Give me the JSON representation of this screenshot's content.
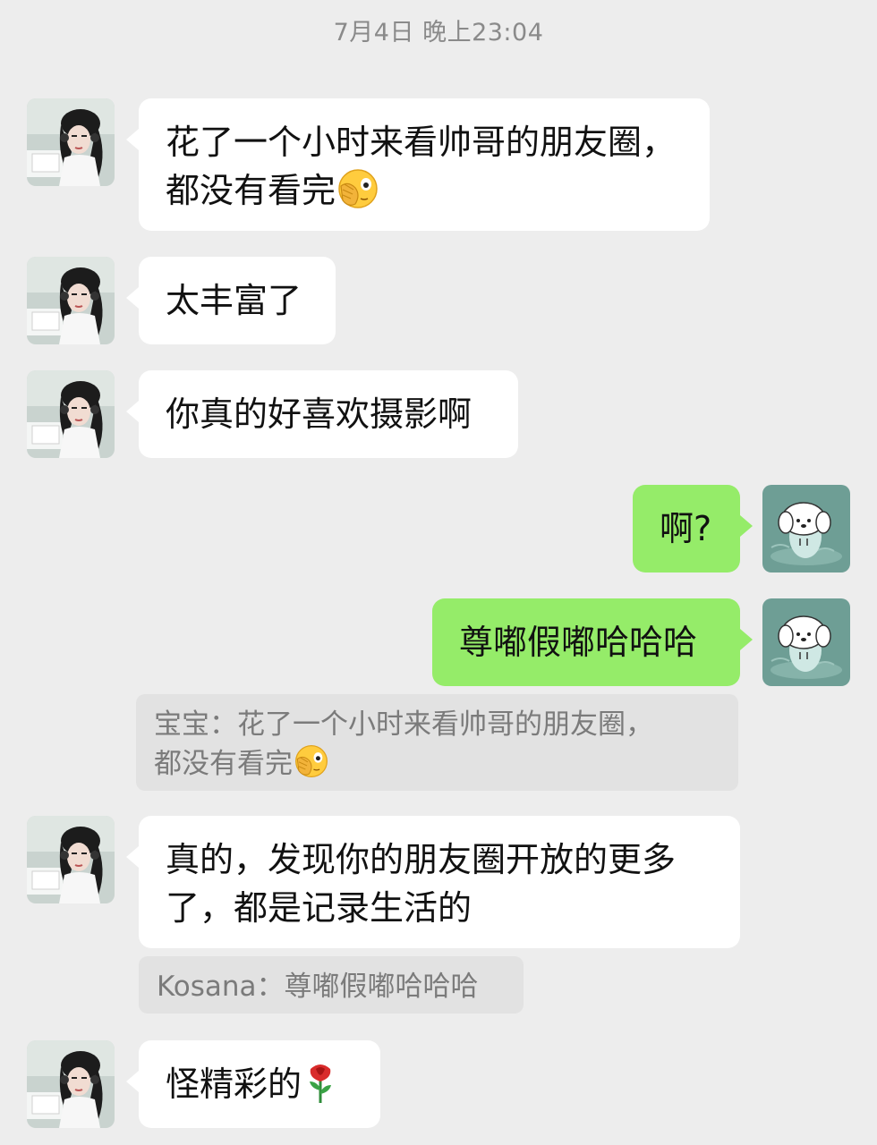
{
  "timestamp": "7月4日 晚上23:04",
  "messages": [
    {
      "side": "in",
      "text": "花了一个小时来看帅哥的朋友圈，",
      "text2": "都没有看完",
      "emoji": "face-with-hand-over-eye-emoji"
    },
    {
      "side": "in",
      "text": "太丰富了"
    },
    {
      "side": "in",
      "text": "你真的好喜欢摄影啊"
    },
    {
      "side": "out",
      "text": "啊?"
    },
    {
      "side": "out",
      "text": "尊嘟假嘟哈哈哈",
      "quote": "宝宝：花了一个小时来看帅哥的朋友圈，",
      "quote2": "都没有看完",
      "quote_emoji": "face-with-hand-over-eye-emoji"
    },
    {
      "side": "in",
      "text": "真的，发现你的朋友圈开放的更多",
      "text2": "了，都是记录生活的",
      "quote": "Kosana：尊嘟假嘟哈哈哈"
    },
    {
      "side": "in",
      "text": "怪精彩的",
      "emoji": "rose-emoji"
    }
  ],
  "colors": {
    "background": "#ededed",
    "incoming_bubble": "#ffffff",
    "outgoing_bubble": "#95ec69",
    "quote_bg": "#e2e2e2",
    "timestamp_text": "#8a8a8a"
  },
  "icons": {
    "contact_avatar": "girl-with-headphones-avatar",
    "my_avatar": "white-puppy-avatar"
  }
}
